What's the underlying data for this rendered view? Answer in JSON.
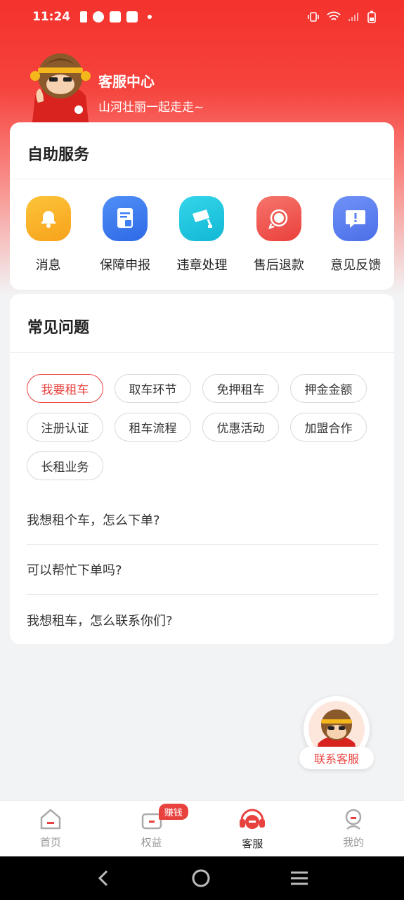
{
  "status_bar": {
    "time": "11:24"
  },
  "header": {
    "title": "客服中心",
    "subtitle": "山河壮丽一起走走~"
  },
  "self_service": {
    "title": "自助服务",
    "items": [
      {
        "label": "消息",
        "icon": "bell-icon",
        "color": "#f9a825"
      },
      {
        "label": "保障申报",
        "icon": "insurance-doc-icon",
        "color": "#3d7ef5"
      },
      {
        "label": "违章处理",
        "icon": "camera-icon",
        "color": "#1ec8e0"
      },
      {
        "label": "售后退款",
        "icon": "refund-yen-icon",
        "color": "#f0524c"
      },
      {
        "label": "意见反馈",
        "icon": "feedback-icon",
        "color": "#5b7ff2"
      }
    ]
  },
  "faq": {
    "title": "常见问题",
    "tags": [
      {
        "label": "我要租车",
        "active": true
      },
      {
        "label": "取车环节",
        "active": false
      },
      {
        "label": "免押租车",
        "active": false
      },
      {
        "label": "押金金额",
        "active": false
      },
      {
        "label": "注册认证",
        "active": false
      },
      {
        "label": "租车流程",
        "active": false
      },
      {
        "label": "优惠活动",
        "active": false
      },
      {
        "label": "加盟合作",
        "active": false
      },
      {
        "label": "长租业务",
        "active": false
      }
    ],
    "questions": [
      "我想租个车，怎么下单?",
      "可以帮忙下单吗?",
      "我想租车，怎么联系你们?"
    ]
  },
  "float_button": {
    "label": "联系客服"
  },
  "tabbar": {
    "tabs": [
      {
        "label": "首页",
        "icon": "home-icon"
      },
      {
        "label": "权益",
        "icon": "benefits-icon",
        "badge": "赚钱"
      },
      {
        "label": "客服",
        "icon": "headset-icon",
        "active": true
      },
      {
        "label": "我的",
        "icon": "profile-icon"
      }
    ]
  },
  "colors": {
    "brand_red": "#e8423f",
    "header_red": "#f4322d"
  }
}
